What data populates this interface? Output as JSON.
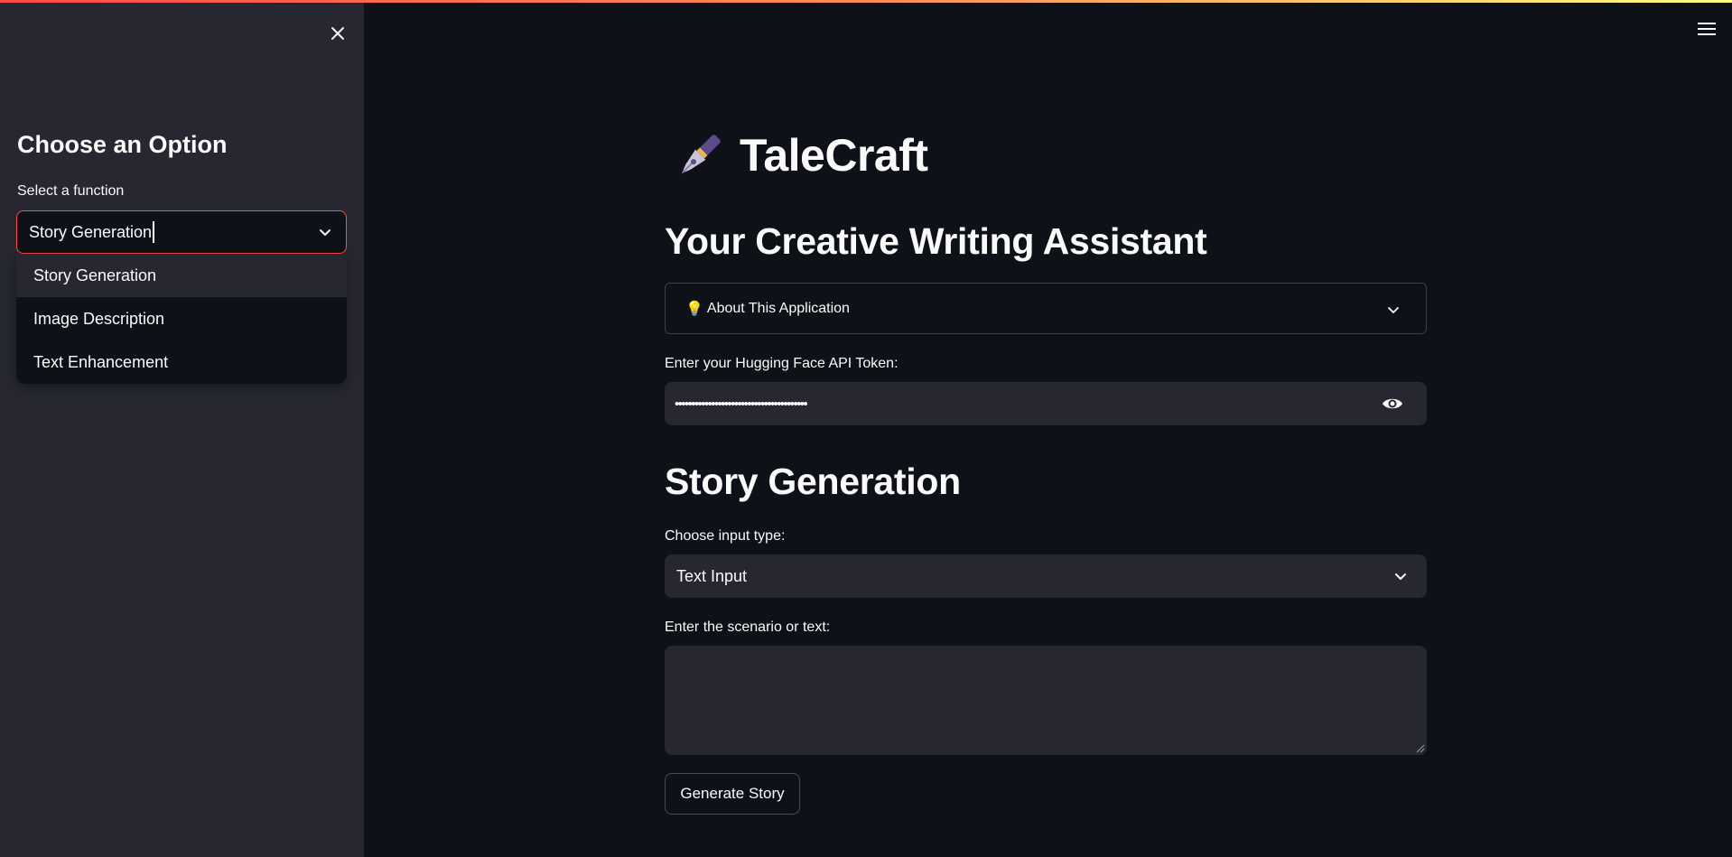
{
  "sidebar": {
    "heading": "Choose an Option",
    "select_label": "Select a function",
    "selected_value": "Story Generation",
    "options": [
      "Story Generation",
      "Image Description",
      "Text Enhancement"
    ]
  },
  "main": {
    "app_title": "TaleCraft",
    "subtitle": "Your Creative Writing Assistant",
    "expander_label": "About This Application",
    "token_label": "Enter your Hugging Face API Token:",
    "token_masked": "••••••••••••••••••••••••••••••••••••••••",
    "section_title": "Story Generation",
    "input_type_label": "Choose input type:",
    "input_type_value": "Text Input",
    "scenario_label": "Enter the scenario or text:",
    "scenario_value": "",
    "generate_button": "Generate Story"
  },
  "icons": {
    "close": "close-icon",
    "menu": "hamburger-menu-icon",
    "chevron": "chevron-down-icon",
    "eye": "eye-icon",
    "logo": "fountain-pen-icon",
    "bulb": "light-bulb-icon"
  },
  "colors": {
    "background": "#0e1117",
    "sidebar": "#262730",
    "input_bg": "#262730",
    "accent": "#ff4b4b",
    "text": "#fafafa"
  }
}
